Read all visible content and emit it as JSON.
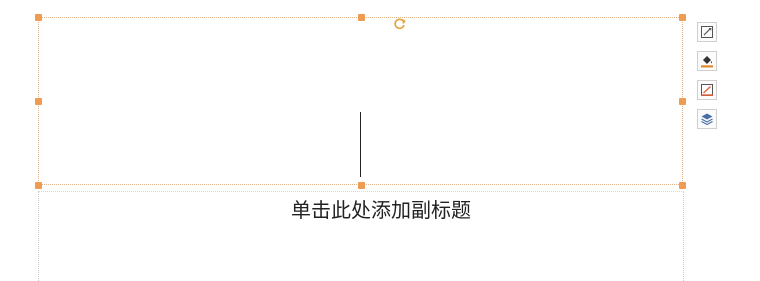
{
  "slide": {
    "subtitle_placeholder": "单击此处添加副标题"
  },
  "toolbar": {
    "buttons": [
      {
        "icon": "shape-outline-icon"
      },
      {
        "icon": "fill-bucket-icon"
      },
      {
        "icon": "line-style-icon"
      },
      {
        "icon": "layers-icon"
      }
    ]
  },
  "colors": {
    "handle": "#ef9b52",
    "selection_border": "#e2b48b",
    "rotate_handle": "#e6a23c",
    "fill_accent": "#e08a2c"
  }
}
